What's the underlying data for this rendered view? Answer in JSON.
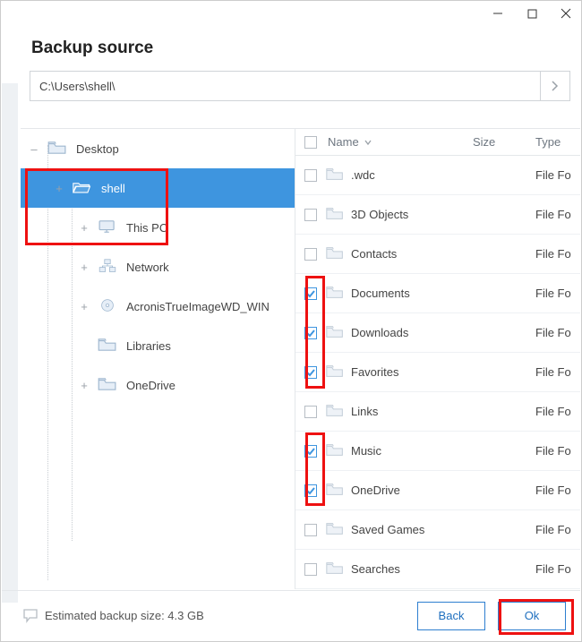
{
  "window": {
    "title": "Backup source"
  },
  "path": {
    "value": "C:\\Users\\shell\\"
  },
  "tree": [
    {
      "label": "Desktop",
      "icon": "folder",
      "depth": 1,
      "expander": "–",
      "selected": false
    },
    {
      "label": "shell",
      "icon": "folder-open",
      "depth": 2,
      "expander": "+",
      "selected": true
    },
    {
      "label": "This PC",
      "icon": "monitor",
      "depth": 3,
      "expander": "+",
      "selected": false
    },
    {
      "label": "Network",
      "icon": "network",
      "depth": 3,
      "expander": "+",
      "selected": false
    },
    {
      "label": "AcronisTrueImageWD_WIN",
      "icon": "disc",
      "depth": 3,
      "expander": "+",
      "selected": false
    },
    {
      "label": "Libraries",
      "icon": "folder",
      "depth": 3,
      "expander": "",
      "selected": false
    },
    {
      "label": "OneDrive",
      "icon": "folder",
      "depth": 3,
      "expander": "+",
      "selected": false
    }
  ],
  "list": {
    "headers": {
      "name": "Name",
      "size": "Size",
      "type": "Type"
    },
    "rows": [
      {
        "name": ".wdc",
        "type": "File Fo",
        "checked": false
      },
      {
        "name": "3D Objects",
        "type": "File Fo",
        "checked": false
      },
      {
        "name": "Contacts",
        "type": "File Fo",
        "checked": false
      },
      {
        "name": "Documents",
        "type": "File Fo",
        "checked": true
      },
      {
        "name": "Downloads",
        "type": "File Fo",
        "checked": true
      },
      {
        "name": "Favorites",
        "type": "File Fo",
        "checked": true
      },
      {
        "name": "Links",
        "type": "File Fo",
        "checked": false
      },
      {
        "name": "Music",
        "type": "File Fo",
        "checked": true
      },
      {
        "name": "OneDrive",
        "type": "File Fo",
        "checked": true
      },
      {
        "name": "Saved Games",
        "type": "File Fo",
        "checked": false
      },
      {
        "name": "Searches",
        "type": "File Fo",
        "checked": false
      }
    ]
  },
  "footer": {
    "estimated": "Estimated backup size: 4.3 GB",
    "back": "Back",
    "ok": "Ok"
  }
}
